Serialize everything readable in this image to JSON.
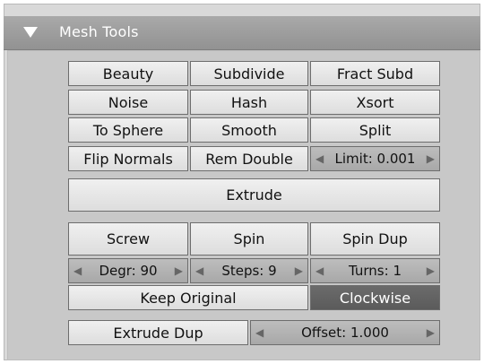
{
  "panel": {
    "title": "Mesh Tools",
    "rows": [
      [
        "Beauty",
        "Subdivide",
        "Fract Subd"
      ],
      [
        "Noise",
        "Hash",
        "Xsort"
      ],
      [
        "To Sphere",
        "Smooth",
        "Split"
      ],
      [
        "Flip Normals",
        "Rem Double",
        "Limit: 0.001"
      ]
    ],
    "extrude": "Extrude",
    "screw": "Screw",
    "spin": "Spin",
    "spin_dup": "Spin Dup",
    "degr": "Degr: 90",
    "steps": "Steps: 9",
    "turns": "Turns: 1",
    "keep_original": "Keep Original",
    "clockwise": "Clockwise",
    "extrude_dup": "Extrude Dup",
    "offset": "Offset: 1.000"
  }
}
